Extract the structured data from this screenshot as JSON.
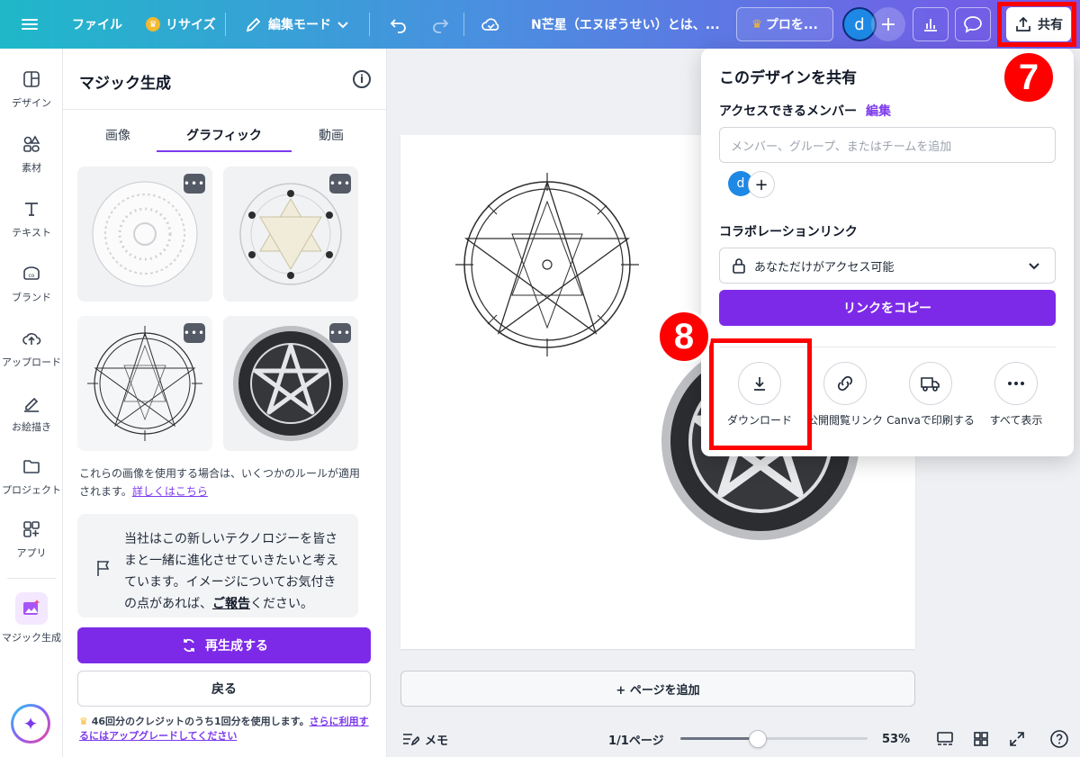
{
  "topbar": {
    "file": "ファイル",
    "resize": "リサイズ",
    "edit_mode": "編集モード",
    "doc_title": "N芒星（エヌぼうせい）とは、...",
    "pro": "プロを...",
    "avatar_initial": "d",
    "share": "共有"
  },
  "annotations": {
    "step7": "7",
    "step8": "8",
    "highlight_color": "#ff0000"
  },
  "rail": {
    "items": [
      {
        "label": "デザイン",
        "icon": "layout-icon"
      },
      {
        "label": "素材",
        "icon": "elements-icon"
      },
      {
        "label": "テキスト",
        "icon": "text-icon"
      },
      {
        "label": "ブランド",
        "icon": "brand-icon"
      },
      {
        "label": "アップロード",
        "icon": "upload-icon"
      },
      {
        "label": "お絵描き",
        "icon": "draw-icon"
      },
      {
        "label": "プロジェクト",
        "icon": "folder-icon"
      },
      {
        "label": "アプリ",
        "icon": "apps-icon"
      },
      {
        "label": "マジック生成",
        "icon": "magic-media-icon"
      }
    ]
  },
  "panel": {
    "title": "マジック生成",
    "tabs": [
      "画像",
      "グラフィック",
      "動画"
    ],
    "active_tab": "グラフィック",
    "notice_text": "これらの画像を使用する場合は、いくつかのルールが適用されます。",
    "notice_link": "詳しくはこちら",
    "feedback_text": "当社はこの新しいテクノロジーを皆さまと一緒に進化させていきたいと考えています。イメージについてお気付きの点があれば、",
    "feedback_link": "ご報告",
    "feedback_suffix": "ください。",
    "regenerate": "再生成する",
    "back": "戻る",
    "credit_text": "46回分のクレジットのうち1回分を使用します。",
    "credit_link": "さらに利用するにはアップグレードしてください"
  },
  "canvas": {
    "add_page": "+ ページを追加"
  },
  "bottombar": {
    "notes": "メモ",
    "page_count": "1/1ページ",
    "zoom": "53%",
    "zoom_fraction": 0.41
  },
  "share_dialog": {
    "title": "このデザインを共有",
    "access_label": "アクセスできるメンバー",
    "edit_link": "編集",
    "member_placeholder": "メンバー、グループ、またはチームを追加",
    "avatar_initial": "d",
    "collab_label": "コラボレーションリンク",
    "access_value": "あなただけがアクセス可能",
    "copy_link": "リンクをコピー",
    "actions": [
      {
        "label": "ダウンロード",
        "icon": "download-icon"
      },
      {
        "label": "公開閲覧リンク",
        "icon": "link-icon"
      },
      {
        "label": "Canvaで印刷する",
        "icon": "truck-icon"
      },
      {
        "label": "すべて表示",
        "icon": "more-icon"
      }
    ]
  },
  "colors": {
    "brand_purple": "#7d2ae8",
    "accent_red": "#ff0000"
  }
}
